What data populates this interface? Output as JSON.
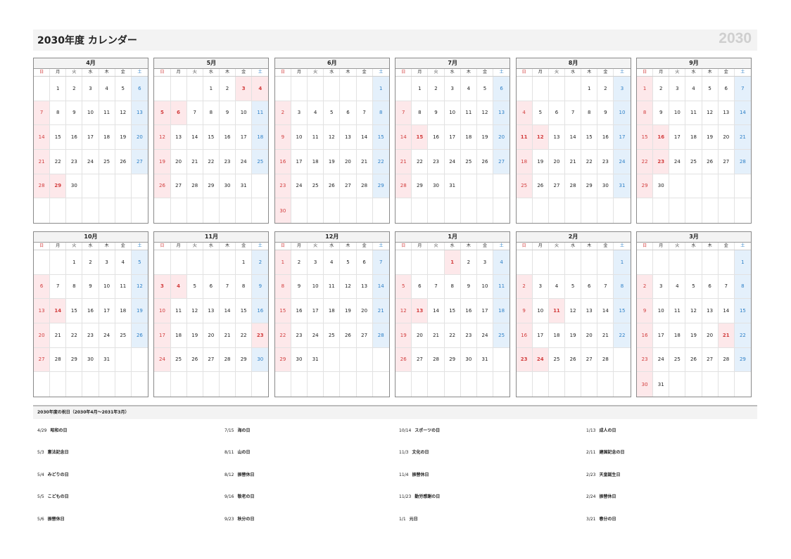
{
  "title": "2030年度 カレンダー",
  "year_mark": "2030",
  "weekdays": [
    "日",
    "月",
    "火",
    "水",
    "木",
    "金",
    "土"
  ],
  "months": [
    {
      "name": "4月",
      "start": 1,
      "days": 30,
      "holidays": [
        29
      ]
    },
    {
      "name": "5月",
      "start": 3,
      "days": 31,
      "holidays": [
        3,
        4,
        5,
        6
      ]
    },
    {
      "name": "6月",
      "start": 6,
      "days": 30,
      "holidays": []
    },
    {
      "name": "7月",
      "start": 1,
      "days": 31,
      "holidays": [
        15
      ]
    },
    {
      "name": "8月",
      "start": 4,
      "days": 31,
      "holidays": [
        11,
        12
      ]
    },
    {
      "name": "9月",
      "start": 0,
      "days": 30,
      "holidays": [
        16,
        23
      ]
    },
    {
      "name": "10月",
      "start": 2,
      "days": 31,
      "holidays": [
        14
      ]
    },
    {
      "name": "11月",
      "start": 5,
      "days": 30,
      "holidays": [
        3,
        4,
        23
      ]
    },
    {
      "name": "12月",
      "start": 0,
      "days": 31,
      "holidays": []
    },
    {
      "name": "1月",
      "start": 3,
      "days": 31,
      "holidays": [
        1,
        13
      ]
    },
    {
      "name": "2月",
      "start": 6,
      "days": 28,
      "holidays": [
        11,
        23,
        24
      ]
    },
    {
      "name": "3月",
      "start": 6,
      "days": 31,
      "holidays": [
        21
      ]
    }
  ],
  "holidays_title": "2030年度の祝日（2030年4月～2031年3月）",
  "holidays": [
    {
      "date": "4/29",
      "name": "昭和の日"
    },
    {
      "date": "5/3",
      "name": "憲法記念日"
    },
    {
      "date": "5/4",
      "name": "みどりの日"
    },
    {
      "date": "5/5",
      "name": "こどもの日"
    },
    {
      "date": "5/6",
      "name": "振替休日"
    },
    {
      "date": "7/15",
      "name": "海の日"
    },
    {
      "date": "8/11",
      "name": "山の日"
    },
    {
      "date": "8/12",
      "name": "振替休日"
    },
    {
      "date": "9/16",
      "name": "敬老の日"
    },
    {
      "date": "9/23",
      "name": "秋分の日"
    },
    {
      "date": "10/14",
      "name": "スポーツの日"
    },
    {
      "date": "11/3",
      "name": "文化の日"
    },
    {
      "date": "11/4",
      "name": "振替休日"
    },
    {
      "date": "11/23",
      "name": "勤労感謝の日"
    },
    {
      "date": "1/1",
      "name": "元日"
    },
    {
      "date": "1/13",
      "name": "成人の日"
    },
    {
      "date": "2/11",
      "name": "建国記念の日"
    },
    {
      "date": "2/23",
      "name": "天皇誕生日"
    },
    {
      "date": "2/24",
      "name": "振替休日"
    },
    {
      "date": "3/21",
      "name": "春分の日"
    }
  ],
  "colors": {
    "sunday": "#d23c3c",
    "saturday": "#2c7fc7",
    "holiday_bg": "#fde8ea",
    "saturday_bg": "#e4f0fb"
  }
}
